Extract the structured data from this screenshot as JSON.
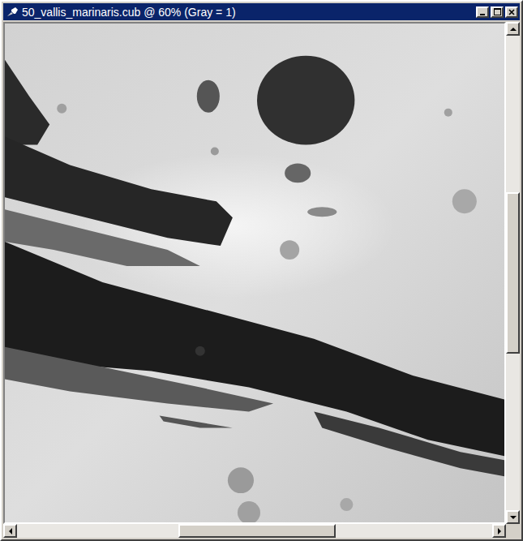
{
  "window": {
    "title": "50_vallis_marinaris.cub @ 60% (Gray = 1)",
    "active": true
  },
  "image": {
    "kind": "photo"
  },
  "vertical_scrollbar": {
    "offset": 0.33,
    "extent": 0.34
  },
  "horizontal_scrollbar": {
    "offset": 0.34,
    "extent": 0.33
  }
}
